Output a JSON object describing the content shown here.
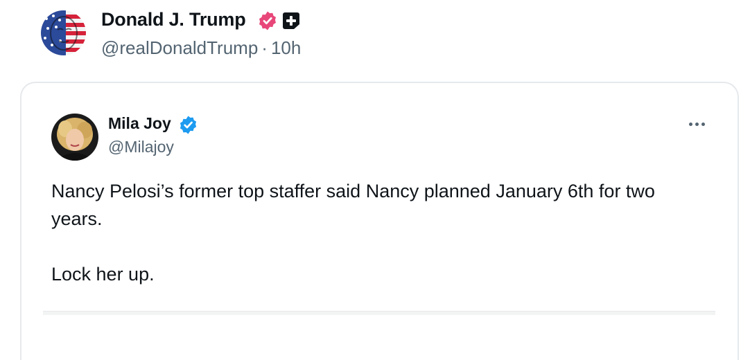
{
  "post": {
    "author": {
      "display_name": "Donald J. Trump",
      "handle": "@realDonaldTrump",
      "separator": "·",
      "time": "10h",
      "badges": [
        "verified-pink-badge-icon",
        "plus-badge-icon"
      ],
      "avatar": "flag-painted-face-avatar"
    },
    "quoted": {
      "author": {
        "display_name": "Mila Joy",
        "handle": "@Milajoy",
        "badges": [
          "verified-blue-badge-icon"
        ],
        "avatar": "blonde-woman-avatar"
      },
      "more_icon": "more-options-icon",
      "text_line_1": "Nancy Pelosi’s former top staffer said Nancy planned January 6th for two years.",
      "text_line_2": "Lock her up."
    }
  },
  "colors": {
    "primary_text": "#0f1419",
    "secondary_text": "#536471",
    "verified_pink": "#e8477a",
    "verified_blue": "#1d9bf0",
    "border": "#e6e9ec"
  }
}
